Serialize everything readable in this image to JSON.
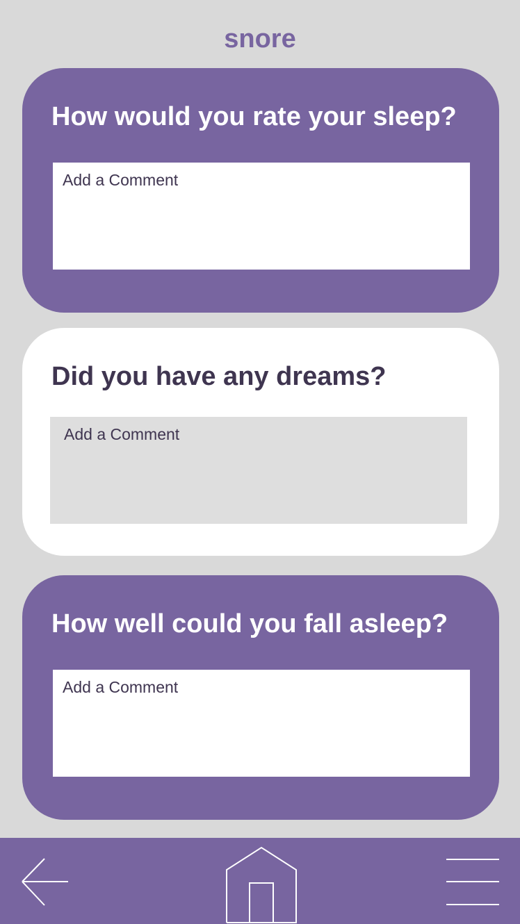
{
  "app": {
    "title": "snore"
  },
  "cards": [
    {
      "question": "How would you rate your sleep?",
      "comment_placeholder": "Add a Comment",
      "comment_value": ""
    },
    {
      "question": "Did you have any dreams?",
      "comment_placeholder": "Add a Comment",
      "comment_value": ""
    },
    {
      "question": "How well could you fall asleep?",
      "comment_placeholder": "Add a Comment",
      "comment_value": ""
    }
  ],
  "bottom_nav": {
    "back_icon": "arrow-left-icon",
    "home_icon": "home-icon",
    "menu_icon": "hamburger-menu-icon"
  },
  "colors": {
    "accent": "#7865a0",
    "background": "#d9d9d9",
    "card_white": "#ffffff",
    "text_dark": "#3f3550",
    "field_gray": "#dedede"
  }
}
